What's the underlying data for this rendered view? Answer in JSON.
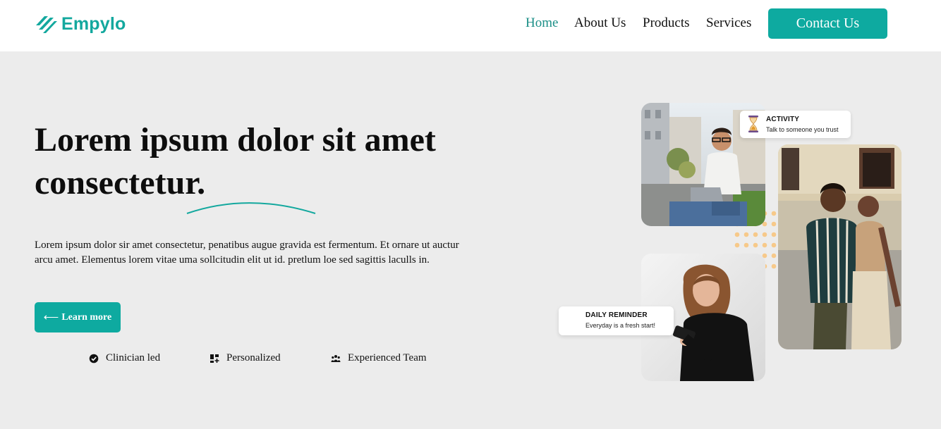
{
  "brand": {
    "name": "Empylo",
    "accent": "#0eaaa0",
    "logo_icon": "slanted-stripes-icon"
  },
  "nav": {
    "items": [
      {
        "label": "Home",
        "active": true
      },
      {
        "label": "About Us",
        "active": false
      },
      {
        "label": "Products",
        "active": false
      },
      {
        "label": "Services",
        "active": false
      }
    ],
    "contact_label": "Contact Us"
  },
  "hero": {
    "title_line1": "Lorem ipsum dolor sit amet",
    "title_line2": "consectetur.",
    "description": "Lorem ipsum dolor sir amet consectetur, penatibus augue gravida est fermentum. Et ornare ut auctur arcu amet. Elementus lorem vitae uma sollcitudin elit ut id. pretlum loe sed sagittis laculls in.",
    "cta_arrow": "⟵",
    "cta_label": "Learn more"
  },
  "features": [
    {
      "label": "Clinician led",
      "icon": "verified-badge-icon"
    },
    {
      "label": "Personalized",
      "icon": "dashboard-grid-icon"
    },
    {
      "label": "Experienced Team",
      "icon": "team-group-icon"
    }
  ],
  "cards": {
    "activity": {
      "title": "ACTIVITY",
      "subtitle": "Talk to someone you trust",
      "icon": "hourglass-icon"
    },
    "reminder": {
      "title": "DAILY REMINDER",
      "subtitle": "Everyday is a fresh start!"
    }
  }
}
